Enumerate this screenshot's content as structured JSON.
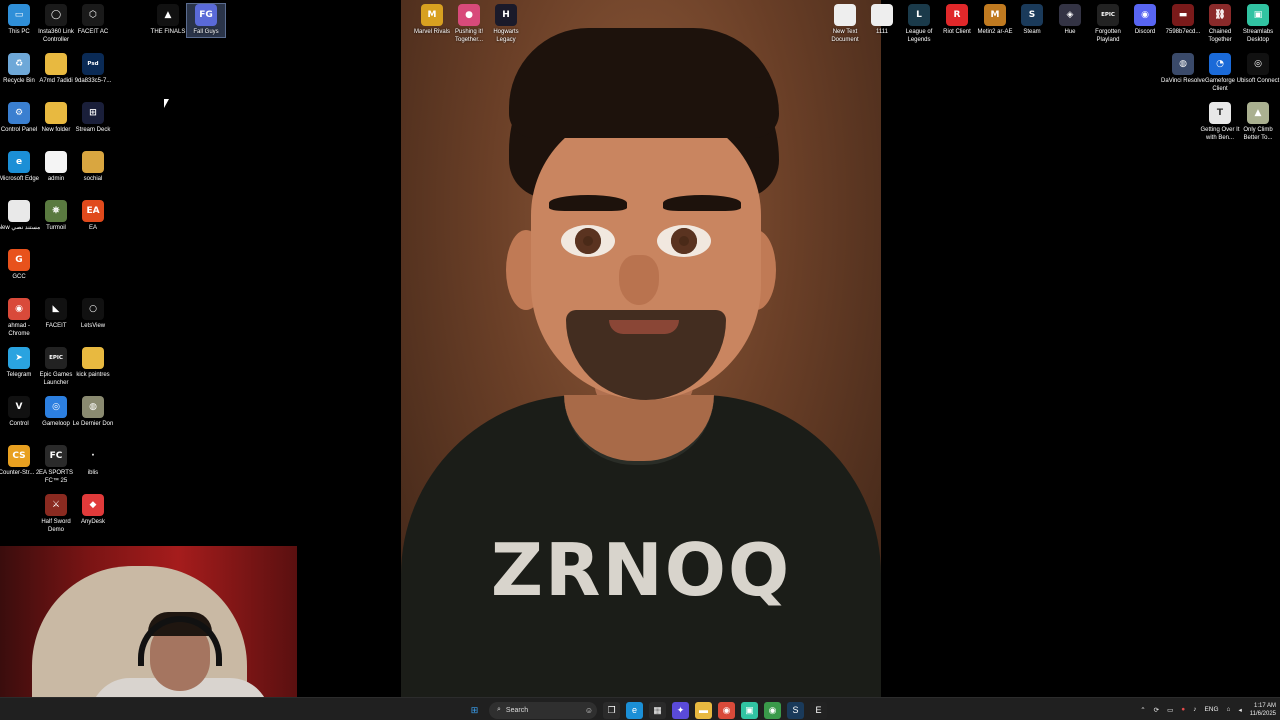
{
  "desktop_icons_left": [
    {
      "label": "This PC",
      "icon": "computer-icon",
      "color": "#2f8fd8",
      "glyph": "▭"
    },
    {
      "label": "Insta360 Link Controller",
      "icon": "camera-app-icon",
      "color": "#1a1a1a",
      "glyph": "◯"
    },
    {
      "label": "FACEIT AC",
      "icon": "faceit-ac-icon",
      "color": "#1a1a1a",
      "glyph": "⬡"
    },
    {
      "label": "Recycle Bin",
      "icon": "recycle-bin-icon",
      "color": "#6ea8d8",
      "glyph": "♻"
    },
    {
      "label": "A7md 7adidi",
      "icon": "folder-icon",
      "color": "#e8b940",
      "glyph": ""
    },
    {
      "label": "9da833c5-7...",
      "icon": "photoshop-file-icon",
      "color": "#0a2a55",
      "glyph": "Psd"
    },
    {
      "label": "Control Panel",
      "icon": "control-panel-icon",
      "color": "#3a7fd0",
      "glyph": "⚙"
    },
    {
      "label": "New folder",
      "icon": "folder-icon",
      "color": "#e8b940",
      "glyph": ""
    },
    {
      "label": "Stream Deck",
      "icon": "stream-deck-icon",
      "color": "#1a1f3a",
      "glyph": "⊞"
    },
    {
      "label": "Microsoft Edge",
      "icon": "edge-icon",
      "color": "#1b8fd6",
      "glyph": "e"
    },
    {
      "label": "admin",
      "icon": "document-icon",
      "color": "#f4f4f4",
      "glyph": ""
    },
    {
      "label": "sochial",
      "icon": "folder-icon",
      "color": "#d9a640",
      "glyph": ""
    },
    {
      "label": "New مستند نصي",
      "icon": "text-document-icon",
      "color": "#e9e9e9",
      "glyph": ""
    },
    {
      "label": "Turmoil",
      "icon": "turmoil-game-icon",
      "color": "#5a7a40",
      "glyph": "⛯"
    },
    {
      "label": "EA",
      "icon": "ea-icon",
      "color": "#e04a1c",
      "glyph": "EA"
    },
    {
      "label": "GCC",
      "icon": "gcc-icon",
      "color": "#e8521c",
      "glyph": "G"
    },
    {
      "label": "ahmad - Chrome",
      "icon": "chrome-icon",
      "color": "#d94a3a",
      "glyph": "◉"
    },
    {
      "label": "FACEIT",
      "icon": "faceit-icon",
      "color": "#111111",
      "glyph": "◣"
    },
    {
      "label": "LetsView",
      "icon": "letsview-icon",
      "color": "#111111",
      "glyph": "○"
    },
    {
      "label": "Telegram",
      "icon": "telegram-icon",
      "color": "#2aa3e0",
      "glyph": "➤"
    },
    {
      "label": "Epic Games Launcher",
      "icon": "epic-games-icon",
      "color": "#222222",
      "glyph": "EPIC"
    },
    {
      "label": "kick paintres",
      "icon": "folder-icon",
      "color": "#e8b940",
      "glyph": ""
    },
    {
      "label": "Control",
      "icon": "control-game-icon",
      "color": "#111111",
      "glyph": "V"
    },
    {
      "label": "Gameloop",
      "icon": "gameloop-icon",
      "color": "#2c7fe0",
      "glyph": "◎"
    },
    {
      "label": "Le Dernier Don",
      "icon": "le-dernier-don-icon",
      "color": "#8a8a70",
      "glyph": "◍"
    },
    {
      "label": "Counter-Str... 2",
      "icon": "counter-strike-icon",
      "color": "#e8a020",
      "glyph": "CS"
    },
    {
      "label": "EA SPORTS FC™ 25",
      "icon": "ea-sports-fc-icon",
      "color": "#2a2a2a",
      "glyph": "FC"
    },
    {
      "label": "iblis",
      "icon": "iblis-icon",
      "color": "#000000",
      "glyph": "·"
    },
    {
      "label": "Half Sword Demo",
      "icon": "half-sword-icon",
      "color": "#8a2a20",
      "glyph": "⚔"
    },
    {
      "label": "AnyDesk",
      "icon": "anydesk-icon",
      "color": "#e03a3a",
      "glyph": "◆"
    }
  ],
  "desktop_icons_top_middle": [
    {
      "label": "THE FINALS",
      "icon": "the-finals-icon",
      "color": "#111111",
      "glyph": "▲",
      "selected": false
    },
    {
      "label": "Fall Guys",
      "icon": "fall-guys-icon",
      "color": "#5a6ad8",
      "glyph": "FG",
      "selected": true
    },
    {
      "label": "Marvel Rivals",
      "icon": "marvel-rivals-icon",
      "color": "#d8a020",
      "glyph": "M"
    },
    {
      "label": "Pushing it! Together...",
      "icon": "pushing-it-icon",
      "color": "#d84a7a",
      "glyph": "●"
    },
    {
      "label": "Hogwarts Legacy",
      "icon": "hogwarts-legacy-icon",
      "color": "#1a1a2a",
      "glyph": "H"
    }
  ],
  "desktop_icons_right": [
    {
      "label": "New Text Document",
      "icon": "text-document-icon",
      "color": "#eeeeee",
      "glyph": ""
    },
    {
      "label": "1111",
      "icon": "text-document-icon",
      "color": "#eeeeee",
      "glyph": ""
    },
    {
      "label": "League of Legends",
      "icon": "league-of-legends-icon",
      "color": "#1a3a4a",
      "glyph": "L"
    },
    {
      "label": "Riot Client",
      "icon": "riot-client-icon",
      "color": "#e0282a",
      "glyph": "R"
    },
    {
      "label": "Metin2 ar-AE",
      "icon": "metin2-icon",
      "color": "#c07a20",
      "glyph": "M"
    },
    {
      "label": "Steam",
      "icon": "steam-icon",
      "color": "#1a3a5a",
      "glyph": "S"
    },
    {
      "label": "Hue",
      "icon": "hue-icon",
      "color": "#333344",
      "glyph": "◈"
    },
    {
      "label": "Forgotten Playland",
      "icon": "epic-games-icon",
      "color": "#222222",
      "glyph": "EPIC"
    },
    {
      "label": "Discord",
      "icon": "discord-icon",
      "color": "#5865f2",
      "glyph": "◉"
    },
    {
      "label": "7598b7ecd...",
      "icon": "image-file-icon",
      "color": "#7a1a1a",
      "glyph": "▬"
    },
    {
      "label": "Chained Together",
      "icon": "chained-together-icon",
      "color": "#8a2a2a",
      "glyph": "⛓"
    },
    {
      "label": "Streamlabs Desktop",
      "icon": "streamlabs-icon",
      "color": "#31c3a2",
      "glyph": "▣"
    },
    {
      "label": "DaVinci Resolve",
      "icon": "davinci-resolve-icon",
      "color": "#3a4a6a",
      "glyph": "◍"
    },
    {
      "label": "Gameforge Client",
      "icon": "gameforge-icon",
      "color": "#1a6ad8",
      "glyph": "◔"
    },
    {
      "label": "Ubisoft Connect",
      "icon": "ubisoft-connect-icon",
      "color": "#111111",
      "glyph": "◎"
    },
    {
      "label": "Getting Over It with Ben...",
      "icon": "getting-over-it-icon",
      "color": "#e8e8e8",
      "glyph": "T"
    },
    {
      "label": "Only Climb Better To...",
      "icon": "only-climb-icon",
      "color": "#aab090",
      "glyph": "▲"
    }
  ],
  "wallpaper": {
    "shirt_text": "ZRNOQ"
  },
  "taskbar": {
    "search_placeholder": "Search",
    "pinned": [
      {
        "icon": "windows-start-icon",
        "color": "#3aa0f0",
        "glyph": "⊞"
      },
      {
        "icon": "task-view-icon",
        "color": "#2a2a2a",
        "glyph": "❐"
      },
      {
        "icon": "edge-icon",
        "color": "#1b8fd6",
        "glyph": "e"
      },
      {
        "icon": "microsoft-store-icon",
        "color": "#2a2a2a",
        "glyph": "▦"
      },
      {
        "icon": "copilot-icon",
        "color": "#5a4ad8",
        "glyph": "✦"
      },
      {
        "icon": "file-explorer-icon",
        "color": "#e8b940",
        "glyph": "▬"
      },
      {
        "icon": "chrome-icon",
        "color": "#d94a3a",
        "glyph": "◉"
      },
      {
        "icon": "streamlabs-icon",
        "color": "#31c3a2",
        "glyph": "▣"
      },
      {
        "icon": "chrome-profile-icon",
        "color": "#3a9a4a",
        "glyph": "◉"
      },
      {
        "icon": "steam-icon",
        "color": "#1a3a5a",
        "glyph": "S"
      },
      {
        "icon": "epic-games-icon",
        "color": "#222222",
        "glyph": "E"
      }
    ],
    "tray": {
      "language": "ENG",
      "time": "1:17 AM",
      "date": "11/6/2025"
    }
  }
}
